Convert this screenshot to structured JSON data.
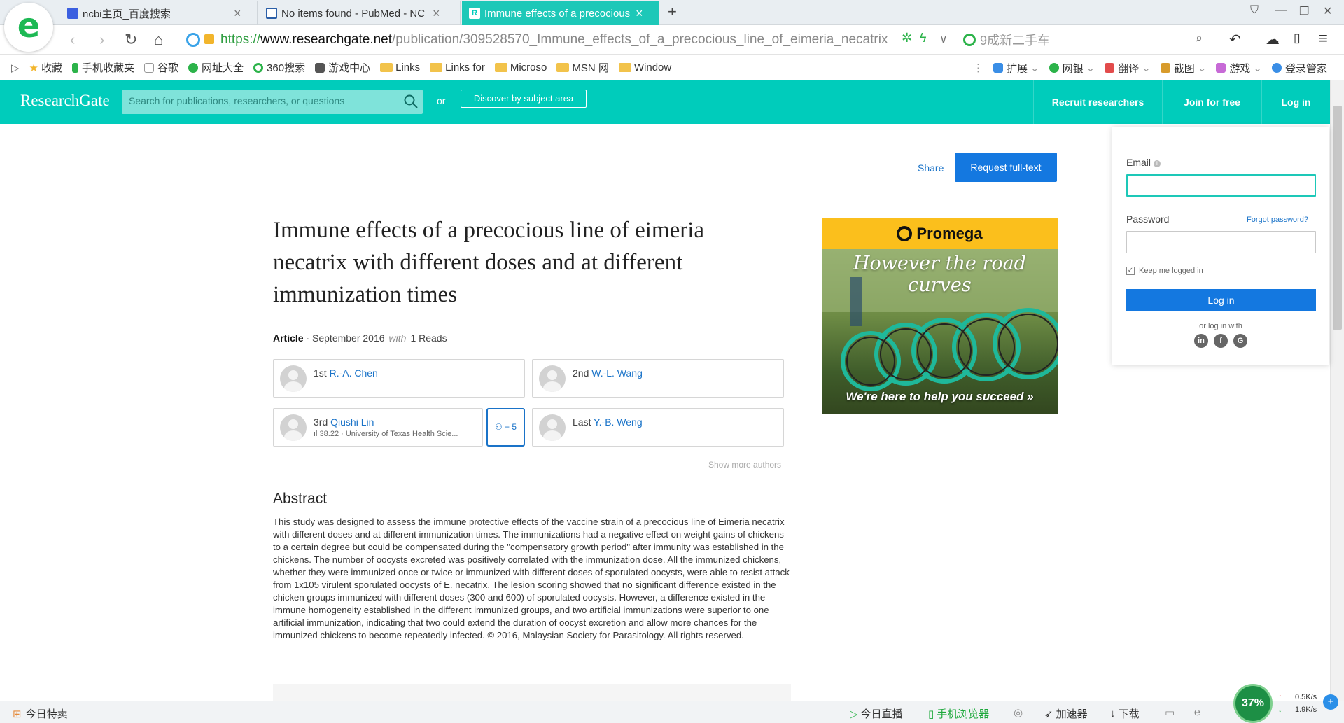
{
  "browser": {
    "tabs": [
      {
        "label": "ncbi主页_百度搜索",
        "icon": "baidu-paw-icon"
      },
      {
        "label": "No items found - PubMed - NC",
        "icon": "dna-icon"
      },
      {
        "label": "Immune effects of a precocious",
        "icon": "researchgate-icon"
      }
    ],
    "url_scheme": "https://",
    "url_domain": "www.researchgate.net",
    "url_path": "/publication/309528570_Immune_effects_of_a_precocious_line_of_eimeria_necatrix",
    "search_hint": "9成新二手车",
    "bookmarks": [
      {
        "label": "收藏",
        "type": "star"
      },
      {
        "label": "手机收藏夹",
        "type": "phone"
      },
      {
        "label": "谷歌",
        "type": "page"
      },
      {
        "label": "网址大全",
        "type": "site"
      },
      {
        "label": "360搜索",
        "type": "search"
      },
      {
        "label": "游戏中心",
        "type": "game"
      },
      {
        "label": "Links",
        "type": "folder"
      },
      {
        "label": "Links for",
        "type": "folder"
      },
      {
        "label": "Microso",
        "type": "folder"
      },
      {
        "label": "MSN 网",
        "type": "folder"
      },
      {
        "label": "Window",
        "type": "folder"
      }
    ],
    "bookmarks_right": [
      "扩展",
      "网银",
      "翻译",
      "截图",
      "游戏",
      "登录管家"
    ]
  },
  "rg": {
    "logo": "ResearchGate",
    "search_placeholder": "Search for publications, researchers, or questions",
    "or": "or",
    "discover": "Discover by subject area",
    "nav": [
      "Recruit researchers",
      "Join for free",
      "Log in"
    ]
  },
  "article": {
    "share": "Share",
    "request": "Request full-text",
    "title": "Immune effects of a precocious line of eimeria necatrix with different doses and at different immunization times",
    "type": "Article",
    "date": "· September 2016",
    "with": "with",
    "reads": "1 Reads",
    "authors": [
      {
        "order": "1st",
        "name": "R.-A. Chen",
        "sub": ""
      },
      {
        "order": "2nd",
        "name": "W.-L. Wang",
        "sub": ""
      },
      {
        "order": "3rd",
        "name": "Qiushi Lin",
        "sub": "ıl 38.22 · University of Texas Health Scie..."
      },
      {
        "order": "Last",
        "name": "Y.-B. Weng",
        "sub": ""
      }
    ],
    "more_authors": "+ 5",
    "show_more": "Show more authors",
    "abstract_heading": "Abstract",
    "abstract": "This study was designed to assess the immune protective effects of the vaccine strain of a precocious line of Eimeria necatrix with different doses and at different immunization times. The immunizations had a negative effect on weight gains of chickens to a certain degree but could be compensated during the \"compensatory growth period\" after immunity was established in the chickens. The number of oocysts excreted was positively correlated with the immunization dose. All the immunized chickens, whether they were immunized once or twice or immunized with different doses of sporulated oocysts, were able to resist attack from 1x105 virulent sporulated oocysts of E. necatrix. The lesion scoring showed that no significant difference existed in the chicken groups immunized with different doses (300 and 600) of sporulated oocysts. However, a difference existed in the immune homogeneity established in the different immunized groups, and two artificial immunizations were superior to one artificial immunization, indicating that two could extend the duration of oocyst excretion and allow more chances for the immunized chickens to become repeatedly infected. © 2016, Malaysian Society for Parasitology. All rights reserved."
  },
  "ad": {
    "brand": "Promega",
    "tagline": "However the road curves",
    "footer": "We're here to help you succeed »"
  },
  "login": {
    "email_label": "Email",
    "password_label": "Password",
    "forgot": "Forgot password?",
    "keep": "Keep me logged in",
    "button": "Log in",
    "or_with": "or log in with",
    "social": [
      "in",
      "f",
      "G"
    ]
  },
  "status": {
    "left": "今日特卖",
    "live": "今日直播",
    "mobile": "手机浏览器",
    "accel": "加速器",
    "download": "下载",
    "percent": "37%",
    "up": "0.5K/s",
    "down": "1.9K/s",
    "notify": "+"
  },
  "colors": {
    "brand": "#00ccbb",
    "link": "#1a73c8",
    "button": "#1478e0"
  }
}
